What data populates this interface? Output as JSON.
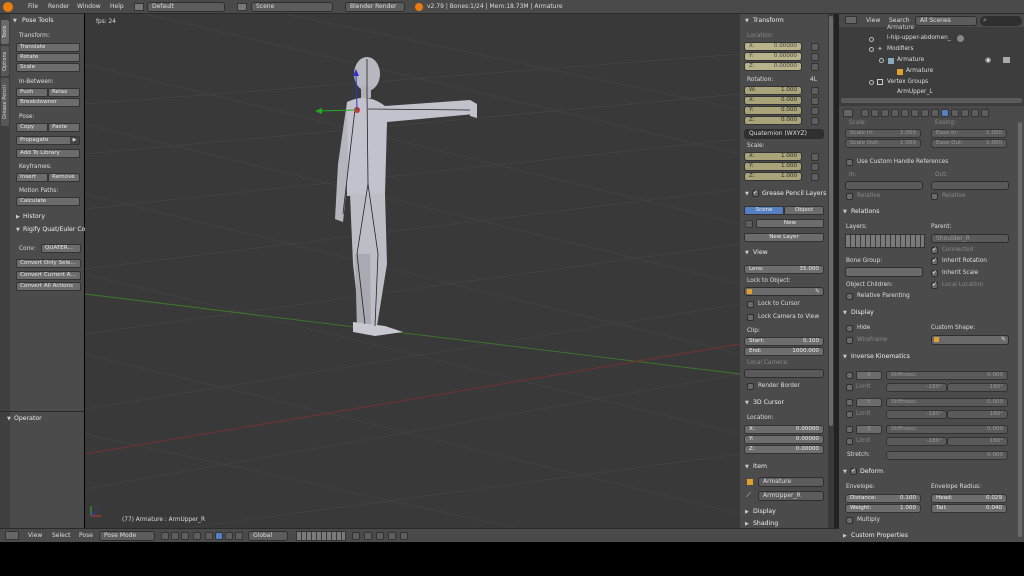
{
  "topbar": {
    "menus": [
      "File",
      "Render",
      "Window",
      "Help"
    ],
    "layout": "Default",
    "scene": "Scene",
    "engine": "Blender Render",
    "stats": "v2.79 | Bones:1/24 | Mem:18.73M | Armature"
  },
  "toolshelf": {
    "tabs": [
      "Tools",
      "Options",
      "Grease Pencil"
    ],
    "title": "Pose Tools",
    "transform_label": "Transform:",
    "translate": "Translate",
    "rotate": "Rotate",
    "scale": "Scale",
    "inbetween_label": "In-Between:",
    "push": "Push",
    "relax": "Relax",
    "breakdowner": "Breakdowner",
    "pose_label": "Pose:",
    "copy": "Copy",
    "paste": "Paste",
    "propagate": "Propagate",
    "add_library": "Add To Library",
    "keyframes_label": "Keyframes:",
    "insert": "Insert",
    "remove": "Remove",
    "motion_label": "Motion Paths:",
    "calculate": "Calculate",
    "history": "History",
    "rigify": "Rigify Quat/Euler Co",
    "conv_label": "Conv:",
    "conv_value": "QUATER...",
    "convert_only": "Convert Only Sele...",
    "convert_current": "Convert Current A...",
    "convert_all": "Convert All Actions",
    "operator": "Operator"
  },
  "viewport": {
    "fps": "fps: 24",
    "status": "(77) Armature : ArmUpper_R"
  },
  "npanel": {
    "transform": "Transform",
    "location": "Location:",
    "loc": [
      {
        "k": "X:",
        "v": "0.00000"
      },
      {
        "k": "Y:",
        "v": "0.00000"
      },
      {
        "k": "Z:",
        "v": "0.00000"
      }
    ],
    "rotation": "Rotation:",
    "rot_lock": "4L",
    "rot": [
      {
        "k": "W:",
        "v": "1.000"
      },
      {
        "k": "X:",
        "v": "0.000"
      },
      {
        "k": "Y:",
        "v": "0.000"
      },
      {
        "k": "Z:",
        "v": "0.000"
      }
    ],
    "rot_mode": "Quaternion (WXYZ)",
    "scale": "Scale:",
    "scl": [
      {
        "k": "X:",
        "v": "1.000"
      },
      {
        "k": "Y:",
        "v": "1.000"
      },
      {
        "k": "Z:",
        "v": "1.000"
      }
    ],
    "grease": "Grease Pencil Layers",
    "gp_scene": "Scene",
    "gp_object": "Object",
    "gp_new": "New",
    "gp_newlayer": "New Layer",
    "view": "View",
    "lens_k": "Lens:",
    "lens_v": "35.000",
    "lock_object": "Lock to Object:",
    "lock_cursor": "Lock to Cursor",
    "lock_camera": "Lock Camera to View",
    "clip": "Clip:",
    "clip_start_k": "Start:",
    "clip_start_v": "0.100",
    "clip_end_k": "End:",
    "clip_end_v": "1000.000",
    "local_camera": "Local Camera:",
    "render_border": "Render Border",
    "cursor": "3D Cursor",
    "cursor_location": "Location:",
    "cur": [
      {
        "k": "X:",
        "v": "0.00000"
      },
      {
        "k": "Y:",
        "v": "0.00000"
      },
      {
        "k": "Z:",
        "v": "0.00000"
      }
    ],
    "item": "Item",
    "item_name": "Armature",
    "item_bone": "ArmUpper_R",
    "display": "Display",
    "shading": "Shading"
  },
  "outliner": {
    "menus": [
      "View",
      "Search"
    ],
    "scenes": "All Scenes",
    "rows": [
      "Armature",
      "l-hip-upper-abdomen_",
      "Modifiers",
      "Armature",
      "Armature",
      "Vertex Groups",
      "ArmUpper_L"
    ]
  },
  "props": {
    "scale_label": "Scale:",
    "easing_label": "Easing:",
    "scale_in_k": "Scale In:",
    "scale_in_v": "1.000",
    "scale_out_k": "Scale Out:",
    "scale_out_v": "1.000",
    "ease_in_k": "Ease In:",
    "ease_in_v": "1.000",
    "ease_out_k": "Ease Out:",
    "ease_out_v": "1.000",
    "custom_handle": "Use Custom Handle References",
    "in_label": "In:",
    "out_label": "Out:",
    "relative": "Relative",
    "relations": "Relations",
    "layers": "Layers:",
    "parent": "Parent:",
    "parent_value": "Shoulder_R",
    "connected": "Connected",
    "bone_group": "Bone Group:",
    "inherit_rotation": "Inherit Rotation",
    "inherit_scale": "Inherit Scale",
    "object_children": "Object Children:",
    "local_location": "Local Location",
    "relative_parenting": "Relative Parenting",
    "display": "Display",
    "hide": "Hide",
    "custom_shape": "Custom Shape:",
    "wireframe": "Wireframe",
    "ik": "Inverse Kinematics",
    "ik_rows": [
      {
        "axis": "X",
        "min": "-180°",
        "max": "180°"
      },
      {
        "axis": "Y",
        "min": "-180°",
        "max": "180°"
      },
      {
        "axis": "Z",
        "min": "-180°",
        "max": "180°"
      }
    ],
    "stiffness": "Stiffness:",
    "stiffness_v": "0.000",
    "limit": "Limit",
    "stretch": "Stretch:",
    "stretch_v": "0.000",
    "deform": "Deform",
    "envelope": "Envelope:",
    "envelope_radius": "Envelope Radius:",
    "distance_k": "Distance:",
    "distance_v": "0.100",
    "weight_k": "Weight:",
    "weight_v": "1.000",
    "head_k": "Head:",
    "head_v": "0.029",
    "tail_k": "Tail:",
    "tail_v": "0.040",
    "multiply": "Multiply",
    "custom_properties": "Custom Properties"
  },
  "bottombar": {
    "menus": [
      "View",
      "Select",
      "Pose"
    ],
    "mode": "Pose Mode",
    "orientation": "Global"
  }
}
